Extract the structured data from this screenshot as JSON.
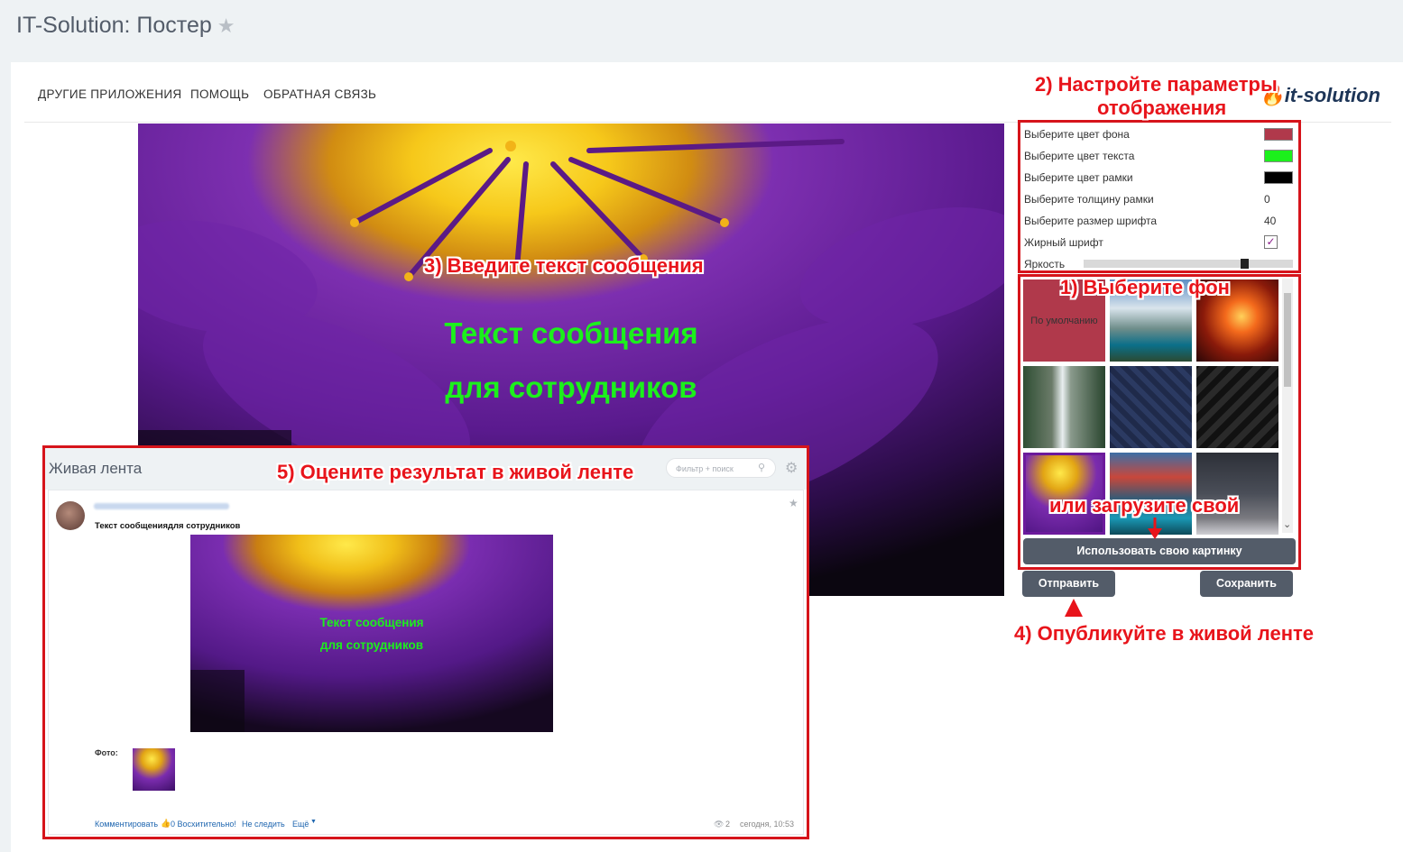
{
  "app": {
    "title": "IT-Solution: Постер",
    "star_glyph": "★"
  },
  "nav": {
    "items": [
      "ДРУГИЕ ПРИЛОЖЕНИЯ",
      "ПОМОЩЬ",
      "ОБРАТНАЯ СВЯЗЬ"
    ],
    "logo": "it-solution"
  },
  "poster": {
    "line1": "Текст сообщения",
    "line2": "для сотрудников"
  },
  "settings": {
    "bg_color_label": "Выберите цвет фона",
    "bg_color": "#b0394b",
    "text_color_label": "Выберите цвет текста",
    "text_color": "#1cf01c",
    "border_color_label": "Выберите цвет рамки",
    "border_color": "#000000",
    "border_width_label": "Выберите толщину рамки",
    "border_width": "0",
    "font_size_label": "Выберите размер шрифта",
    "font_size": "40",
    "bold_label": "Жирный шрифт",
    "bold_checked": "✓",
    "brightness_label": "Яркость",
    "brightness": 0.78
  },
  "gallery": {
    "default_label": "По умолчанию",
    "scroll_down_glyph": "⌄",
    "upload_button": "Использовать свою картинку"
  },
  "actions": {
    "send": "Отправить",
    "save": "Сохранить"
  },
  "callouts": {
    "c1": "1) Выберите фон",
    "c2a": "2) Настройте параметры",
    "c2b": "отображения",
    "c3": "3) Введите текст сообщения",
    "c4": "4) Опубликуйте в живой ленте",
    "c5": "5) Оцените результат в живой ленте",
    "upload_own": "или загрузите свой"
  },
  "feed": {
    "title": "Живая лента",
    "search_placeholder": "Фильтр + поиск",
    "post_text": "Текст сообщениядля сотрудников",
    "poster_line1": "Текст сообщения",
    "poster_line2": "для сотрудников",
    "photo_label": "Фото:",
    "comment": "Комментировать",
    "likes": "0 Восхитительно!",
    "unfollow": "Не следить",
    "more": "Ещё",
    "views": "2",
    "time": "сегодня, 10:53"
  }
}
